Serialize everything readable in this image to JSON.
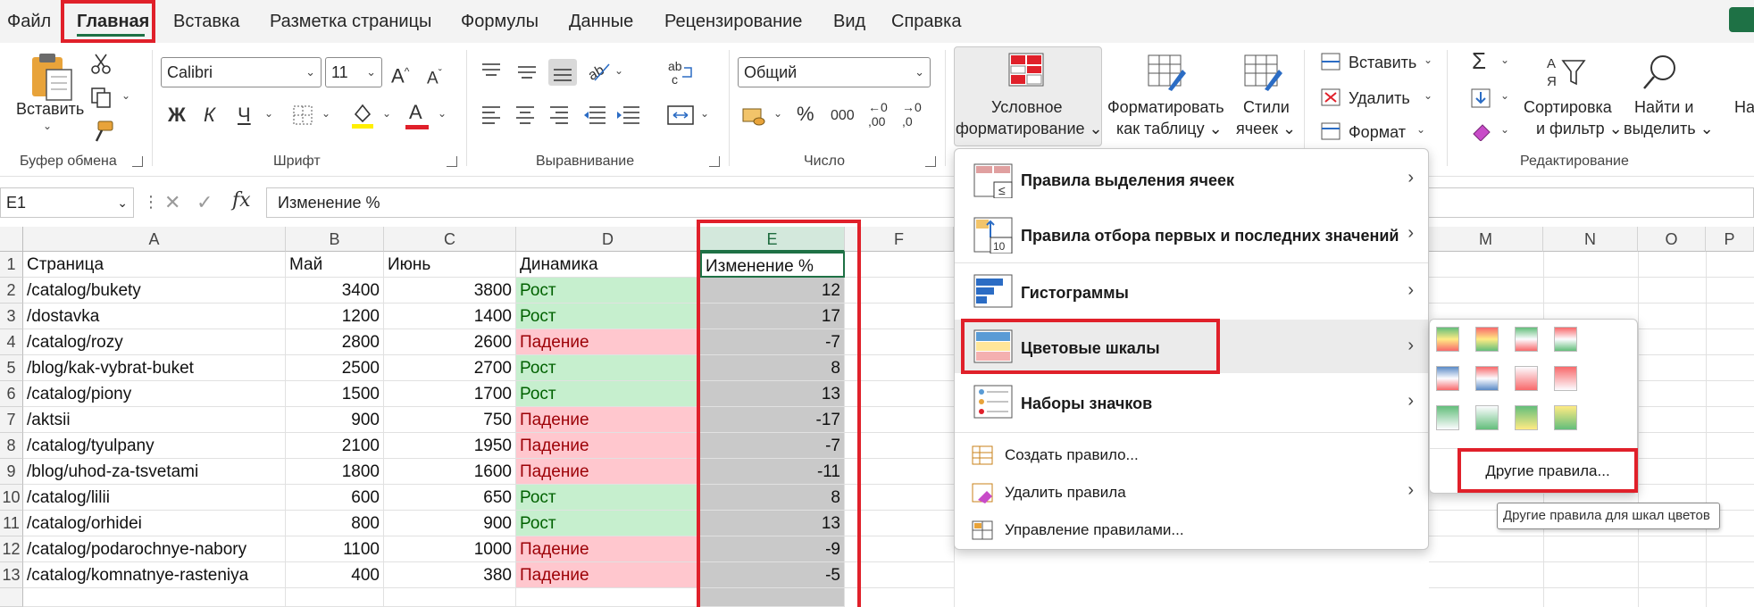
{
  "menu": {
    "file": "Файл",
    "home": "Главная",
    "insert": "Вставка",
    "page_layout": "Разметка страницы",
    "formulas": "Формулы",
    "data": "Данные",
    "review": "Рецензирование",
    "view": "Вид",
    "help": "Справка"
  },
  "ribbon": {
    "clipboard": {
      "paste": "Вставить",
      "group": "Буфер обмена"
    },
    "font": {
      "name": "Calibri",
      "size": "11",
      "group": "Шрифт",
      "bold": "Ж",
      "italic": "К",
      "underline": "Ч",
      "grow": "A",
      "shrink": "A",
      "color_letter": "A"
    },
    "alignment": {
      "group": "Выравнивание"
    },
    "number": {
      "format": "Общий",
      "group": "Число",
      "percent": "%",
      "thousands": "000",
      "inc": ",00",
      "dec": ",0"
    },
    "styles": {
      "cond_format_line1": "Условное",
      "cond_format_line2": "форматирование",
      "format_table_line1": "Форматировать",
      "format_table_line2": "как таблицу",
      "cell_styles_line1": "Стили",
      "cell_styles_line2": "ячеек"
    },
    "cells": {
      "insert": "Вставить",
      "delete": "Удалить",
      "format": "Формат"
    },
    "editing": {
      "group": "Редактирование",
      "sort_line1": "Сортировка",
      "sort_line2": "и фильтр",
      "find_line1": "Найти и",
      "find_line2": "выделить",
      "sum": "Σ",
      "cut_off": "На"
    }
  },
  "formula_bar": {
    "name_box": "E1",
    "fx": "fx",
    "content": "Изменение %"
  },
  "columns": [
    "A",
    "B",
    "C",
    "D",
    "E",
    "F",
    "M",
    "N",
    "O",
    "P"
  ],
  "headers": [
    "Страница",
    "Май",
    "Июнь",
    "Динамика",
    "Изменение %"
  ],
  "rows": [
    {
      "n": "1"
    },
    {
      "n": "2",
      "page": "/catalog/bukety",
      "may": "3400",
      "june": "3800",
      "trend": "Рост",
      "change": "12"
    },
    {
      "n": "3",
      "page": "/dostavka",
      "may": "1200",
      "june": "1400",
      "trend": "Рост",
      "change": "17"
    },
    {
      "n": "4",
      "page": "/catalog/rozy",
      "may": "2800",
      "june": "2600",
      "trend": "Падение",
      "change": "-7"
    },
    {
      "n": "5",
      "page": "/blog/kak-vybrat-buket",
      "may": "2500",
      "june": "2700",
      "trend": "Рост",
      "change": "8"
    },
    {
      "n": "6",
      "page": "/catalog/piony",
      "may": "1500",
      "june": "1700",
      "trend": "Рост",
      "change": "13"
    },
    {
      "n": "7",
      "page": "/aktsii",
      "may": "900",
      "june": "750",
      "trend": "Падение",
      "change": "-17"
    },
    {
      "n": "8",
      "page": "/catalog/tyulpany",
      "may": "2100",
      "june": "1950",
      "trend": "Падение",
      "change": "-7"
    },
    {
      "n": "9",
      "page": "/blog/uhod-za-tsvetami",
      "may": "1800",
      "june": "1600",
      "trend": "Падение",
      "change": "-11"
    },
    {
      "n": "10",
      "page": "/catalog/lilii",
      "may": "600",
      "june": "650",
      "trend": "Рост",
      "change": "8"
    },
    {
      "n": "11",
      "page": "/catalog/orhidei",
      "may": "800",
      "june": "900",
      "trend": "Рост",
      "change": "13"
    },
    {
      "n": "12",
      "page": "/catalog/podarochnye-nabory",
      "may": "1100",
      "june": "1000",
      "trend": "Падение",
      "change": "-9"
    },
    {
      "n": "13",
      "page": "/catalog/komnatnye-rasteniya",
      "may": "400",
      "june": "380",
      "trend": "Падение",
      "change": "-5"
    }
  ],
  "cf_menu": {
    "highlight_rules": "Правила выделения ячеек",
    "top_bottom": "Правила отбора первых и последних значений",
    "data_bars": "Гистограммы",
    "color_scales": "Цветовые шкалы",
    "icon_sets": "Наборы значков",
    "new_rule": "Создать правило...",
    "clear_rules": "Удалить правила",
    "manage_rules": "Управление правилами..."
  },
  "color_scale_menu": {
    "more_rules": "Другие правила...",
    "tooltip": "Другие правила для шкал цветов"
  },
  "colors": {
    "accent": "#1e7145",
    "annotation": "#e0202a",
    "grow_fill": "#c6efce",
    "fall_fill": "#ffc7ce"
  }
}
